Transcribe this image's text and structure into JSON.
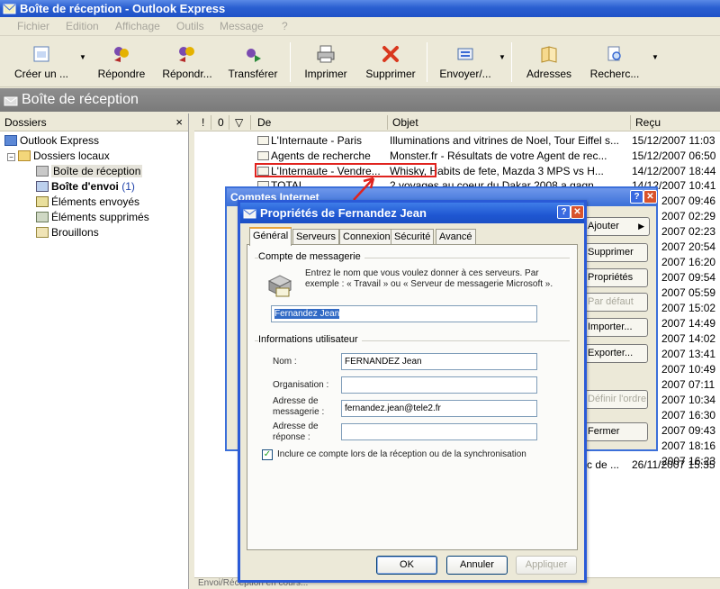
{
  "window": {
    "title": "Boîte de réception - Outlook Express"
  },
  "menu": [
    "Fichier",
    "Edition",
    "Affichage",
    "Outils",
    "Message",
    "?"
  ],
  "toolbar": {
    "create": "Créer un ...",
    "reply": "Répondre",
    "reply_all": "Répondr...",
    "forward": "Transférer",
    "print": "Imprimer",
    "delete": "Supprimer",
    "send": "Envoyer/...",
    "addresses": "Adresses",
    "search": "Recherc..."
  },
  "folder_header": "Boîte de réception",
  "folders": {
    "title": "Dossiers",
    "close": "×",
    "root": "Outlook Express",
    "local": "Dossiers locaux",
    "inbox": "Boîte de réception",
    "outbox": "Boîte d'envoi",
    "outbox_count": "(1)",
    "sent": "Éléments envoyés",
    "deleted": "Éléments supprimés",
    "drafts": "Brouillons"
  },
  "list": {
    "col_from": "De",
    "col_subject": "Objet",
    "col_received": "Reçu",
    "rows": [
      {
        "from": "L'Internaute - Paris",
        "subject": "Illuminations and vitrines de Noel, Tour Eiffel s...",
        "date": "15/12/2007 11:03"
      },
      {
        "from": "Agents de recherche",
        "subject": "Monster.fr - Résultats de votre Agent de rec...",
        "date": "15/12/2007 06:50"
      },
      {
        "from": "L'Internaute - Vendre...",
        "subject": "Whisky, Habits de fete, Mazda 3 MPS vs H...",
        "date": "14/12/2007 18:44"
      },
      {
        "from": "TOTAL",
        "subject": "2 voyages au coeur du Dakar 2008 a gagn...",
        "date": "14/12/2007 10:41"
      }
    ],
    "dates_partial": [
      "2007 09:46",
      "2007 02:29",
      "2007 02:23",
      "2007 20:54",
      "2007 16:20",
      "2007 09:54",
      "2007 05:59",
      "2007 15:02",
      "2007 14:49",
      "2007 14:02",
      "2007 13:41",
      "2007 10:49",
      "2007 07:11",
      "2007 10:34",
      "2007 16:30",
      "2007 09:43",
      "2007 18:16",
      "2007 16:23"
    ],
    "last_row": {
      "subject_tail": "c de ...",
      "date": "26/11/2007 15:35"
    }
  },
  "status": "Envoi/Réception en cours...",
  "comptes": {
    "title": "Comptes Internet",
    "btn_add": "Ajouter",
    "btn_remove": "Supprimer",
    "btn_props": "Propriétés",
    "btn_default": "Par défaut",
    "btn_import": "Importer...",
    "btn_export": "Exporter...",
    "btn_order": "Définir l'ordre...",
    "btn_close": "Fermer"
  },
  "props": {
    "title": "Propriétés de Fernandez Jean",
    "tabs": [
      "Général",
      "Serveurs",
      "Connexion",
      "Sécurité",
      "Avancé"
    ],
    "group_account": "Compte de messagerie",
    "hint": "Entrez le nom que vous voulez donner à ces serveurs. Par exemple : « Travail » ou « Serveur de messagerie Microsoft ».",
    "account_name": "Fernandez Jean",
    "group_user": "Informations utilisateur",
    "lbl_name": "Nom :",
    "name": "FERNANDEZ Jean",
    "lbl_org": "Organisation :",
    "org": "",
    "lbl_email": "Adresse de messagerie :",
    "email": "fernandez.jean@tele2.fr",
    "lbl_reply": "Adresse de réponse :",
    "reply": "",
    "include_label": "Inclure ce compte lors de la réception ou de la synchronisation",
    "include_checked": true,
    "btn_ok": "OK",
    "btn_cancel": "Annuler",
    "btn_apply": "Appliquer"
  },
  "colors": {
    "xp_blue": "#2a5ad7",
    "annotation_red": "#e0231e"
  }
}
